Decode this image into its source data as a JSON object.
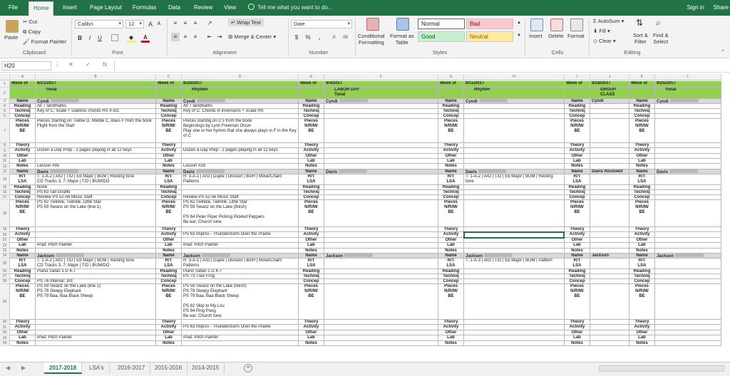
{
  "menu": {
    "tabs": [
      "File",
      "Home",
      "Insert",
      "Page Layout",
      "Formulas",
      "Data",
      "Review",
      "View"
    ],
    "active": "Home",
    "tell_me": "Tell me what you want to do...",
    "sign_in": "Sign in",
    "share": "Share"
  },
  "ribbon": {
    "clipboard": {
      "paste": "Paste",
      "cut": "Cut",
      "copy": "Copy",
      "format_painter": "Format Painter",
      "label": "Clipboard"
    },
    "font": {
      "name": "Calibri",
      "size": "12",
      "bold": "B",
      "italic": "I",
      "underline": "U",
      "grow": "A",
      "shrink": "A",
      "label": "Font"
    },
    "alignment": {
      "wrap": "Wrap Text",
      "merge": "Merge & Center",
      "label": "Alignment"
    },
    "number": {
      "format": "Date",
      "currency": "$",
      "percent": "%",
      "comma": ",",
      "label": "Number"
    },
    "styles": {
      "conditional": "Conditional\nFormatting",
      "format_table": "Format as\nTable",
      "normal": "Normal",
      "bad": "Bad",
      "good": "Good",
      "neutral": "Neutral",
      "label": "Styles"
    },
    "cells": {
      "insert": "Insert",
      "delete": "Delete",
      "format": "Format",
      "label": "Cells"
    },
    "editing": {
      "autosum": "AutoSum",
      "fill": "Fill",
      "clear": "Clear",
      "sort": "Sort &\nFilter",
      "find": "Find &\nSelect",
      "label": "Editing"
    }
  },
  "formula_bar": {
    "name_box": "H20",
    "fx": "fx",
    "content": ""
  },
  "columns": [
    "A",
    "B",
    "C",
    "D",
    "E",
    "F",
    "G",
    "H",
    "I",
    "J",
    "K",
    "L"
  ],
  "weeks": [
    {
      "label": "Week of",
      "date": "8/21/2017",
      "topic": "Tonal"
    },
    {
      "label": "Week of",
      "date": "8/28/2017",
      "topic": "Rhythm"
    },
    {
      "label": "Week of",
      "date": "9/4/2017",
      "topic": "LABOR DAY\nTonal"
    },
    {
      "label": "Week of",
      "date": "9/11/2017",
      "topic": "Rhythm"
    },
    {
      "label": "Week of",
      "date": "9/18/2017",
      "topic": "GROUP CLASS"
    },
    {
      "label": "Week of",
      "date": "9/25/2017",
      "topic": "Tonal"
    }
  ],
  "rows": [
    {
      "n": "3",
      "label": "Name",
      "h": 7,
      "type": "name",
      "vals": [
        "Cyndi",
        "Cyndi",
        "Cyndi",
        "Cyndi",
        "Cyndi",
        "Cyndi"
      ]
    },
    {
      "n": "4",
      "label": "Reading",
      "h": 7,
      "vals": [
        "All 7 landmarks",
        "All 7 landmarks",
        "",
        "",
        "",
        ""
      ]
    },
    {
      "n": "5",
      "label": "Techniq",
      "h": 7,
      "vals": [
        "Key of C: Scale + Diatonic chords HS 4 oct.",
        "Key of C: Chords in inversions + Scale HS",
        "",
        "",
        "",
        ""
      ]
    },
    {
      "n": "6",
      "label": "Concep",
      "h": 7,
      "vals": [
        "",
        "",
        "",
        "",
        "",
        ""
      ]
    },
    {
      "n": "7",
      "label": "Pieces\nN/R/M/\nBE",
      "h": 34,
      "vals": [
        "Pieces Starting on Treble G, Middle C, Bass F from the book Flight from the Start",
        "Pieces starting on C's from the book\nBeginnings by Lynn Freeman Olson\nPlay one or her hymns that she always plays in F in the Key of C",
        "",
        "",
        "",
        ""
      ]
    },
    {
      "n": "8",
      "label": "Theory",
      "h": 7,
      "vals": [
        "",
        "",
        "",
        "",
        "",
        ""
      ]
    },
    {
      "n": "9",
      "label": "Activity",
      "h": 8,
      "vals": [
        "Dozen a Day Prep - 2 pages playing in all 12 keys",
        "Dozen a Day Prep - 2 pages playing in all 12 keys",
        "",
        "",
        "",
        ""
      ]
    },
    {
      "n": "10",
      "label": "Other",
      "h": 7,
      "vals": [
        "",
        "",
        "",
        "",
        "",
        ""
      ]
    },
    {
      "n": "11",
      "label": "Lab",
      "h": 7,
      "vals": [
        "",
        "",
        "",
        "",
        "",
        ""
      ]
    },
    {
      "n": "12",
      "label": "Notes",
      "h": 8,
      "vals": [
        "Lesson #95",
        "Lesson #26",
        "",
        "",
        "",
        ""
      ]
    },
    {
      "n": "13",
      "label": "Name",
      "h": 7,
      "type": "name",
      "vals": [
        "Davis",
        "Davis",
        "Davis",
        "Davis",
        "Davis Rockwell",
        "Davis"
      ]
    },
    {
      "n": "14",
      "label": "R/T\nLSA",
      "h": 15,
      "vals": [
        "T: 1-A-2 | A/O | T/D | Eb Major | BUM | Resting tone\nCD Tracks 3, 7; Major | T/D | BUM/DO",
        "R: 3-A-1 | A/O | Duple | Division | BAH | Move/Chant\nPatterns",
        "",
        "T: 1-A-2 | A/O | T/D | Eb Major | BUM | Resting tone\nCD Tracks 3, 7; Major | T/D | BUM/DO",
        "",
        ""
      ]
    },
    {
      "n": "15",
      "label": "Reading",
      "h": 7,
      "vals": [
        "None",
        "",
        "",
        "",
        "",
        ""
      ]
    },
    {
      "n": "16",
      "label": "Techniq",
      "h": 7,
      "vals": [
        "PS 63 Tall Giraffe",
        "",
        "",
        "",
        "",
        ""
      ]
    },
    {
      "n": "17",
      "label": "Concep",
      "h": 7,
      "vals": [
        "Review PS 52-56 Music Staff",
        "Review PS 52-56 Music Staff",
        "",
        "",
        "",
        ""
      ]
    },
    {
      "n": "18",
      "label": "Pieces\nN/R/M/\nBE",
      "h": 38,
      "vals": [
        "PS 62 Twinkle, Twinkle, Little Star\nPS 59 Swanz on the Lake (line 1)",
        "PS 62 Twinkle, Twinkle, Little Star\nPS 59 Swanz on the Lake (finish)\n\nPS 64 Peter Piper Picking Pickled Peppers\nBe ear: Church tone",
        "",
        "",
        "",
        ""
      ]
    },
    {
      "n": "19",
      "label": "Theory",
      "h": 7,
      "vals": [
        "",
        "",
        "",
        "",
        "",
        ""
      ]
    },
    {
      "n": "20",
      "label": "Activity",
      "h": 8,
      "vals": [
        "",
        "PS 63 Improv - Thunderstorm Over the Prairie",
        "",
        "",
        "",
        ""
      ]
    },
    {
      "n": "21",
      "label": "Other",
      "h": 7,
      "vals": [
        "",
        "",
        "",
        "",
        "",
        ""
      ]
    },
    {
      "n": "22",
      "label": "Lab",
      "h": 8,
      "vals": [
        "iPad: Pitch Painter",
        "iPad: Pitch Painter",
        "",
        "",
        "",
        ""
      ]
    },
    {
      "n": "23",
      "label": "Notes",
      "h": 7,
      "vals": [
        "",
        "",
        "",
        "",
        "",
        ""
      ]
    },
    {
      "n": "24",
      "label": "Name",
      "h": 7,
      "type": "name",
      "vals": [
        "Jackson",
        "Jackson",
        "Jackson",
        "Jackson",
        "Jackson",
        "Jackson"
      ]
    },
    {
      "n": "25",
      "label": "R/T\nLSA",
      "h": 15,
      "vals": [
        "T: 1-A-2 | A/O | T/D | Eb Major | BUM | Resting tone\nCD Tracks 3, 7; Major | T/D | BUM/DO",
        "R: 3-A-1 | A/O | Duple | Division | BAH | Move/Chant\nPatterns",
        "",
        "T: 1-A-3 | A/O | T/D | Eb Major | BUM | Pattern",
        "",
        ""
      ]
    },
    {
      "n": "26",
      "label": "Reading",
      "h": 7,
      "vals": [
        "Piano Safari 1 D 4-7",
        "Piano Safari 1 D 4-7",
        "",
        "",
        "",
        ""
      ]
    },
    {
      "n": "27",
      "label": "Techniq",
      "h": 7,
      "vals": [
        "",
        "PS 73 Tree Frog",
        "",
        "",
        "",
        ""
      ]
    },
    {
      "n": "28",
      "label": "Concep",
      "h": 7,
      "vals": [
        "PS 76 Interval: 3rd",
        "",
        "",
        "",
        "",
        ""
      ]
    },
    {
      "n": "29",
      "label": "Pieces\nN/R/M/\nBE",
      "h": 50,
      "vals": [
        "PS 59 Swanz on the Lake (line 1)\nPS 78 Sleepy Elephant\nPS 79 Baa, Baa Black Sheep",
        "PS 59 Swanz on the Lake (finish)\nPS 78 Sleepy Elephant\nPS 79 Baa, Baa Black Sheep\n\nPS 82 Skip to My Lou\nPS 84 Ping Pong\nBe ear: Church tone",
        "",
        "",
        "",
        ""
      ]
    },
    {
      "n": "30",
      "label": "Theory",
      "h": 7,
      "vals": [
        "",
        "",
        "",
        "",
        "",
        ""
      ]
    },
    {
      "n": "31",
      "label": "Activity",
      "h": 8,
      "vals": [
        "",
        "PS 63 Improv - Thunderstorm Over the Prairie",
        "",
        "",
        "",
        ""
      ]
    },
    {
      "n": "32",
      "label": "Other",
      "h": 7,
      "vals": [
        "",
        "",
        "",
        "",
        "",
        ""
      ]
    },
    {
      "n": "33",
      "label": "Lab",
      "h": 8,
      "vals": [
        "iPad: Pitch Painter",
        "iPad: Pitch Painter",
        "",
        "",
        "",
        ""
      ]
    },
    {
      "n": "34",
      "label": "Notes",
      "h": 7,
      "vals": [
        "",
        "",
        "",
        "",
        "",
        ""
      ]
    }
  ],
  "sheets": [
    "2017-2018",
    "LSA's",
    "2016-2017",
    "2015-2016",
    "2014-2015"
  ],
  "active_sheet": "2017-2018",
  "colors": {
    "accent": "#217346",
    "header_green": "#92d050",
    "name_grey": "#d9d9d9",
    "bad_bg": "#ffc7ce",
    "good_bg": "#c6efce",
    "neutral_bg": "#ffeb9c"
  }
}
